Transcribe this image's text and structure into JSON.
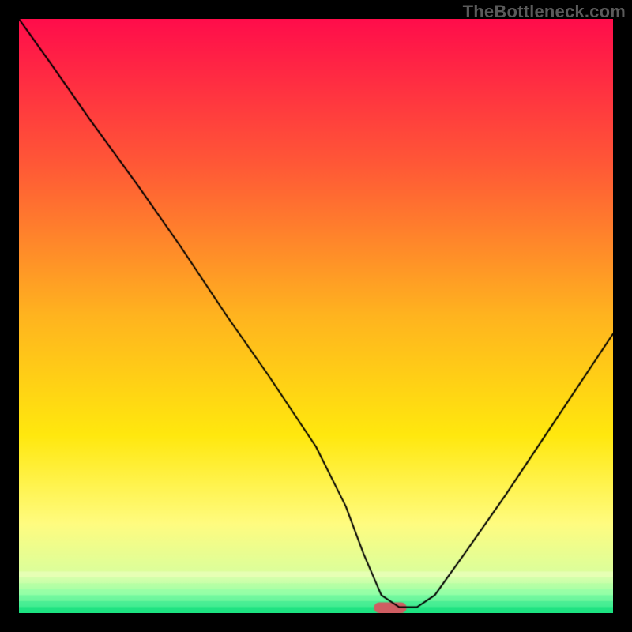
{
  "watermark": "TheBottleneck.com",
  "chart_data": {
    "type": "line",
    "title": "",
    "xlabel": "",
    "ylabel": "",
    "xlim": [
      0,
      100
    ],
    "ylim": [
      0,
      100
    ],
    "grid": false,
    "legend": null,
    "background_gradient_stops": [
      {
        "y": 100,
        "color": "#ff0d4b"
      },
      {
        "y": 75,
        "color": "#ff5a36"
      },
      {
        "y": 50,
        "color": "#ffb41f"
      },
      {
        "y": 30,
        "color": "#ffe80e"
      },
      {
        "y": 15,
        "color": "#fffc80"
      },
      {
        "y": 6,
        "color": "#d8ff9e"
      },
      {
        "y": 3,
        "color": "#8affa0"
      },
      {
        "y": 0,
        "color": "#10e87a"
      }
    ],
    "series": [
      {
        "name": "bottleneck-curve",
        "stroke": "#000000",
        "stroke_width": 2.0,
        "x": [
          0,
          5,
          12,
          20,
          27,
          35,
          42,
          50,
          55,
          58,
          61,
          64,
          67,
          70,
          75,
          82,
          90,
          100
        ],
        "y": [
          100,
          93,
          83,
          72,
          62,
          50,
          40,
          28,
          18,
          10,
          3,
          1,
          1,
          3,
          10,
          20,
          32,
          47
        ]
      }
    ],
    "bottom_marker": {
      "x_center": 62.5,
      "width": 5.5,
      "height": 1.8,
      "fill": "#cf5d62",
      "rx": 1.0
    }
  }
}
